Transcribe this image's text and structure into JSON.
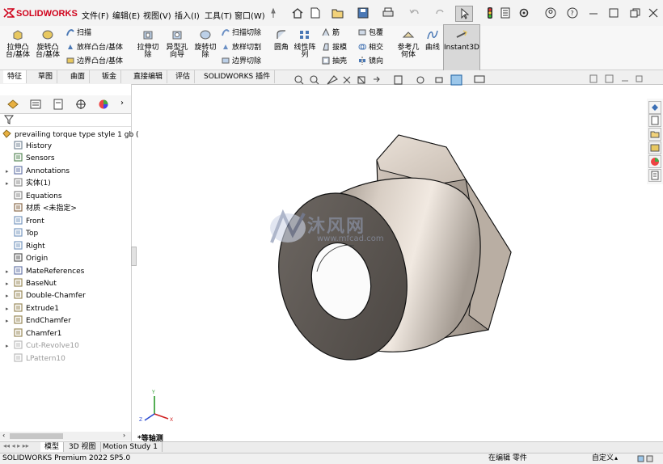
{
  "app": {
    "brand": "SOLIDWORKS",
    "brand_color": "#d0021b"
  },
  "menu": [
    "文件(F)",
    "编辑(E)",
    "视图(V)",
    "插入(I)",
    "工具(T)",
    "窗口(W)"
  ],
  "ribbon": {
    "extrude_boss": "拉伸凸\n台/基体",
    "revolve_boss": "旋转凸\n台/基体",
    "sweep": "扫描",
    "loft": "放样凸台/基体",
    "boundary_boss": "边界凸台/基体",
    "extrude_cut": "拉伸切\n除",
    "hole_wizard": "异型孔\n向导",
    "revolve_cut": "旋转切\n除",
    "swept_cut": "扫描切除",
    "lofted_cut": "放样切割",
    "boundary_cut": "边界切除",
    "fillet": "圆角",
    "linear_pattern": "线性阵\n列",
    "rib": "筋",
    "draft": "拔模",
    "shell": "抽壳",
    "wrap": "包覆",
    "intersect": "相交",
    "mirror": "镜向",
    "ref_geometry": "参考几\n何体",
    "curves": "曲线",
    "instant3d": "Instant3D"
  },
  "tabs": [
    "特征",
    "草图",
    "曲面",
    "钣金",
    "直接编辑",
    "评估",
    "SOLIDWORKS 插件"
  ],
  "tree": {
    "root": "prevailing torque type style 1 gb (",
    "items": [
      {
        "label": "History",
        "expand": false,
        "grey": false
      },
      {
        "label": "Sensors",
        "expand": false,
        "grey": false
      },
      {
        "label": "Annotations",
        "expand": true,
        "grey": false
      },
      {
        "label": "实体(1)",
        "expand": true,
        "grey": false
      },
      {
        "label": "Equations",
        "expand": false,
        "grey": false
      },
      {
        "label": "材质 <未指定>",
        "expand": false,
        "grey": false
      },
      {
        "label": "Front",
        "expand": false,
        "grey": false
      },
      {
        "label": "Top",
        "expand": false,
        "grey": false
      },
      {
        "label": "Right",
        "expand": false,
        "grey": false
      },
      {
        "label": "Origin",
        "expand": false,
        "grey": false
      },
      {
        "label": "MateReferences",
        "expand": true,
        "grey": false
      },
      {
        "label": "BaseNut",
        "expand": true,
        "grey": false
      },
      {
        "label": "Double-Chamfer",
        "expand": true,
        "grey": false
      },
      {
        "label": "Extrude1",
        "expand": true,
        "grey": false
      },
      {
        "label": "EndChamfer",
        "expand": true,
        "grey": false
      },
      {
        "label": "Chamfer1",
        "expand": false,
        "grey": false
      },
      {
        "label": "Cut-Revolve10",
        "expand": true,
        "grey": true
      },
      {
        "label": "LPattern10",
        "expand": false,
        "grey": true
      }
    ]
  },
  "viewport": {
    "view_label": "*等轴测",
    "watermark_cn": "沐风网",
    "watermark_url": "www.mfcad.com"
  },
  "bottom_tabs": [
    "模型",
    "3D 视图",
    "Motion Study 1"
  ],
  "status": {
    "version": "SOLIDWORKS Premium 2022 SP5.0",
    "editing": "在编辑 零件",
    "custom": "自定义"
  }
}
